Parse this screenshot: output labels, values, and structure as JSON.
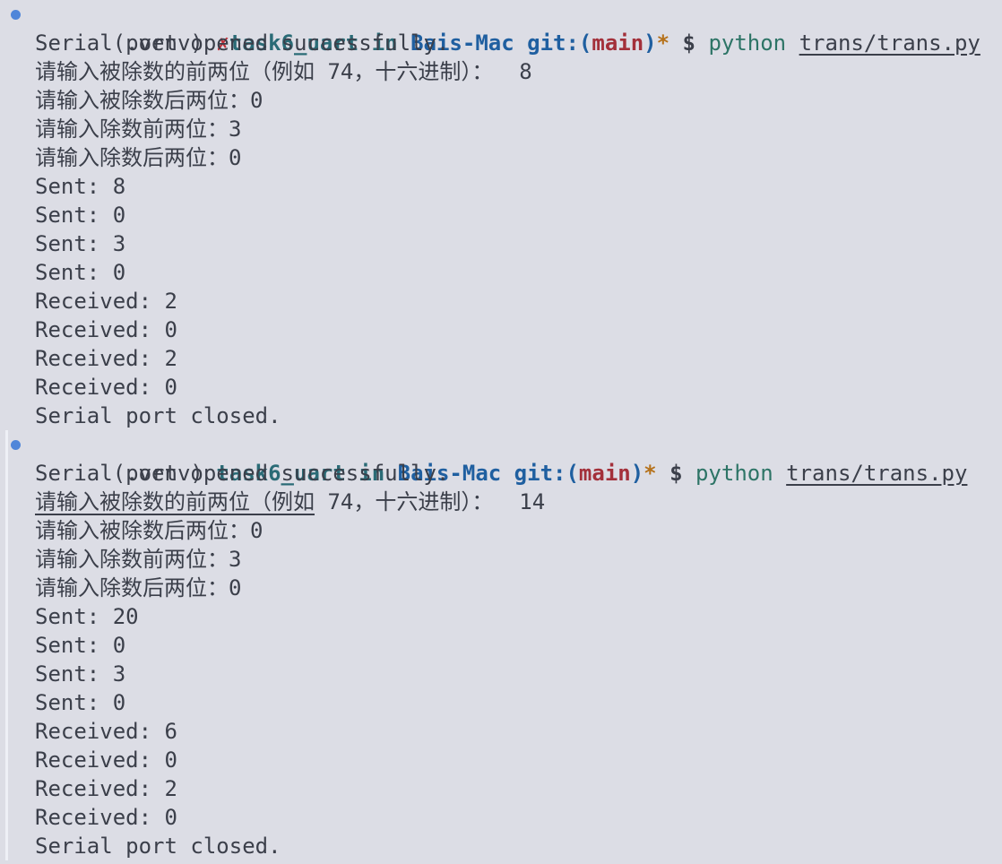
{
  "prompt": {
    "venv": "(.venv)",
    "dirty_mark": "✗",
    "dir": "task6_uart",
    "in_word": "in",
    "host": "Bais-Mac",
    "git_label": "git:(",
    "branch": "main",
    "git_close": ")",
    "dirty_star": "*",
    "dollar": "$",
    "command": "python",
    "argument": "trans/trans.py"
  },
  "runs": [
    {
      "opened": "Serial port opened successfully.",
      "q1": "请输入被除数的前两位（例如 74，十六进制）：",
      "a1": "8",
      "q2": "请输入被除数后两位：",
      "a2": "0",
      "q3": "请输入除数前两位：",
      "a3": "3",
      "q4": "请输入除数后两位：",
      "a4": "0",
      "sent": [
        "Sent: 8",
        "Sent: 0",
        "Sent: 3",
        "Sent: 0"
      ],
      "received": [
        "Received: 2",
        "Received: 0",
        "Received: 2",
        "Received: 0"
      ],
      "closed": "Serial port closed."
    },
    {
      "opened": "Serial port opened successfully.",
      "q1": "请输入被除数的前两位（例如",
      "q1_rest": " 74，十六进制）：",
      "a1": "14",
      "q2": "请输入被除数后两位：",
      "a2": "0",
      "q3": "请输入除数前两位：",
      "a3": "3",
      "q4": "请输入除数后两位：",
      "a4": "0",
      "sent": [
        "Sent: 20",
        "Sent: 0",
        "Sent: 3",
        "Sent: 0"
      ],
      "received": [
        "Received: 6",
        "Received: 0",
        "Received: 2",
        "Received: 0"
      ],
      "closed": "Serial port closed."
    }
  ],
  "colors": {
    "background": "#dcdde5",
    "prompt_dot": "#4f86d9",
    "branch": "#a3303a",
    "host": "#1f5fa0",
    "dir": "#2a6b76"
  }
}
